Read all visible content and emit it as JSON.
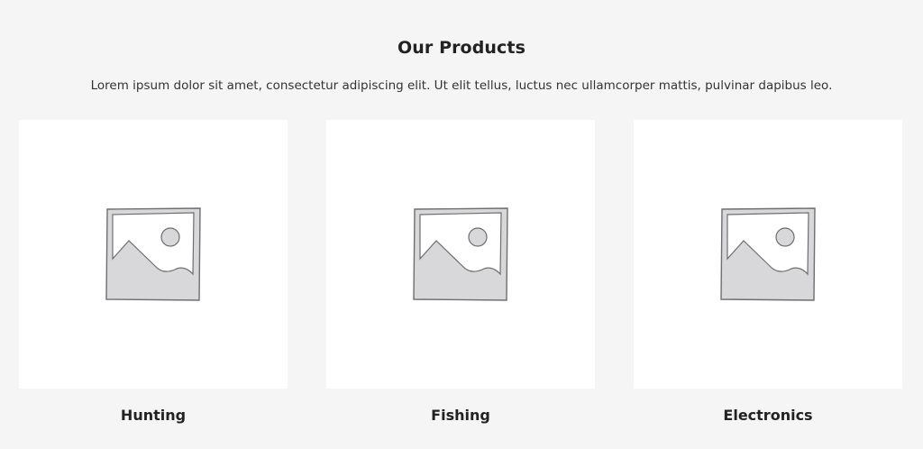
{
  "section": {
    "title": "Our Products",
    "description": "Lorem ipsum dolor sit amet, consectetur adipiscing elit. Ut elit tellus, luctus nec ullamcorper mattis, pulvinar dapibus leo."
  },
  "products": [
    {
      "name": "Hunting",
      "image_icon": "image-placeholder-icon"
    },
    {
      "name": "Fishing",
      "image_icon": "image-placeholder-icon"
    },
    {
      "name": "Electronics",
      "image_icon": "image-placeholder-icon"
    }
  ],
  "colors": {
    "page_background": "#f5f5f5",
    "card_background": "#ffffff",
    "placeholder_fill": "#d8d8da",
    "placeholder_stroke": "#6e6e70",
    "text": "#222222"
  }
}
